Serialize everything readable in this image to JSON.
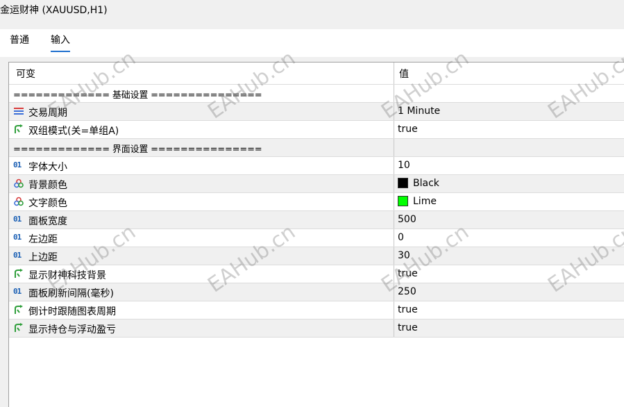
{
  "window": {
    "title": "金运财神 (XAUUSD,H1)"
  },
  "tabs": [
    {
      "label": "普通"
    },
    {
      "label": "输入"
    }
  ],
  "grid": {
    "headers": {
      "variable": "可变",
      "value": "值"
    },
    "sections": [
      {
        "label": "============= 基础设置 ==============="
      },
      {
        "label": "============= 界面设置 ==============="
      }
    ],
    "rows": [
      {
        "label": "交易周期",
        "value": "1 Minute",
        "icon": "enum-icon"
      },
      {
        "label": "双组模式(关=单组A)",
        "value": "true",
        "icon": "bool-arrow-icon"
      },
      {
        "label": "字体大小",
        "value": "10",
        "icon": "number-icon"
      },
      {
        "label": "背景颜色",
        "value": "Black",
        "icon": "color-icon",
        "color": "#000000"
      },
      {
        "label": "文字颜色",
        "value": "Lime",
        "icon": "color-icon",
        "color": "#00ff00"
      },
      {
        "label": "面板宽度",
        "value": "500",
        "icon": "number-icon"
      },
      {
        "label": "左边距",
        "value": "0",
        "icon": "number-icon"
      },
      {
        "label": "上边距",
        "value": "30",
        "icon": "number-icon"
      },
      {
        "label": "显示财神科技背景",
        "value": "true",
        "icon": "bool-arrow-icon"
      },
      {
        "label": "面板刷新间隔(毫秒)",
        "value": "250",
        "icon": "number-icon"
      },
      {
        "label": "倒计时跟随图表周期",
        "value": "true",
        "icon": "bool-arrow-icon"
      },
      {
        "label": "显示持仓与浮动盈亏",
        "value": "true",
        "icon": "bool-arrow-icon"
      }
    ],
    "number_icon_text": "01"
  },
  "watermark": "EAHub.cn",
  "colors": {
    "tab_accent": "#1f6fce",
    "alt_row": "#f0f0f0",
    "number_icon": "#1a5fb4",
    "bool_icon": "#2e9e3a"
  }
}
